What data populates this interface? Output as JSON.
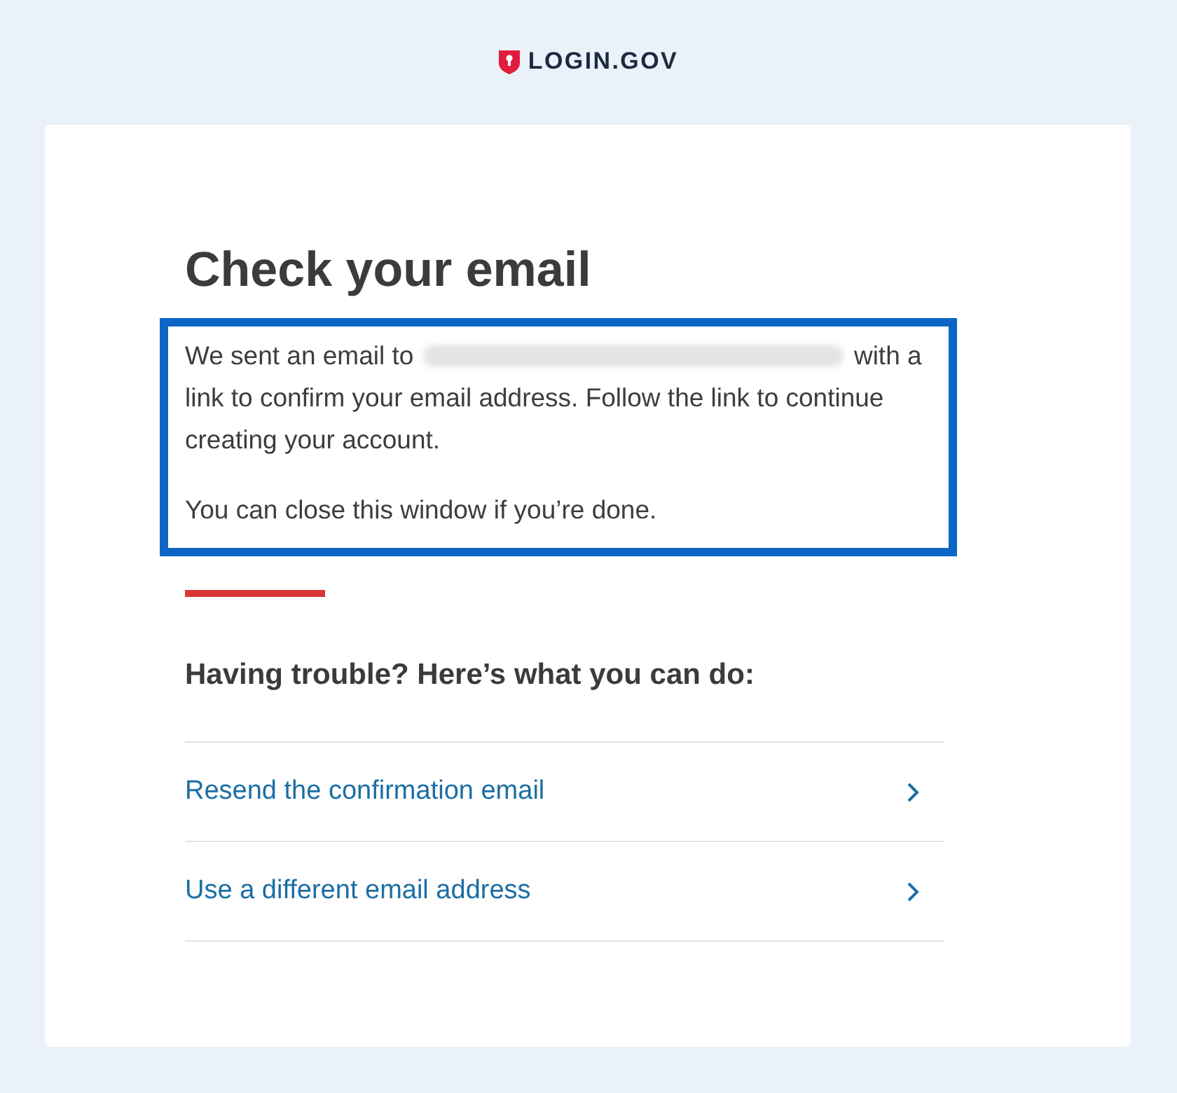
{
  "logo": {
    "text": "LOGIN.GOV"
  },
  "heading": "Check your email",
  "message": {
    "highlighted": true,
    "before": "We sent an email to",
    "redacted": true,
    "after": "with a link to confirm your email address. Follow the link to continue creating your account.",
    "note": "You can close this window if you’re done."
  },
  "trouble": {
    "heading": "Having trouble? Here’s what you can do:",
    "options": [
      {
        "label": "Resend the confirmation email"
      },
      {
        "label": "Use a different email address"
      }
    ]
  }
}
